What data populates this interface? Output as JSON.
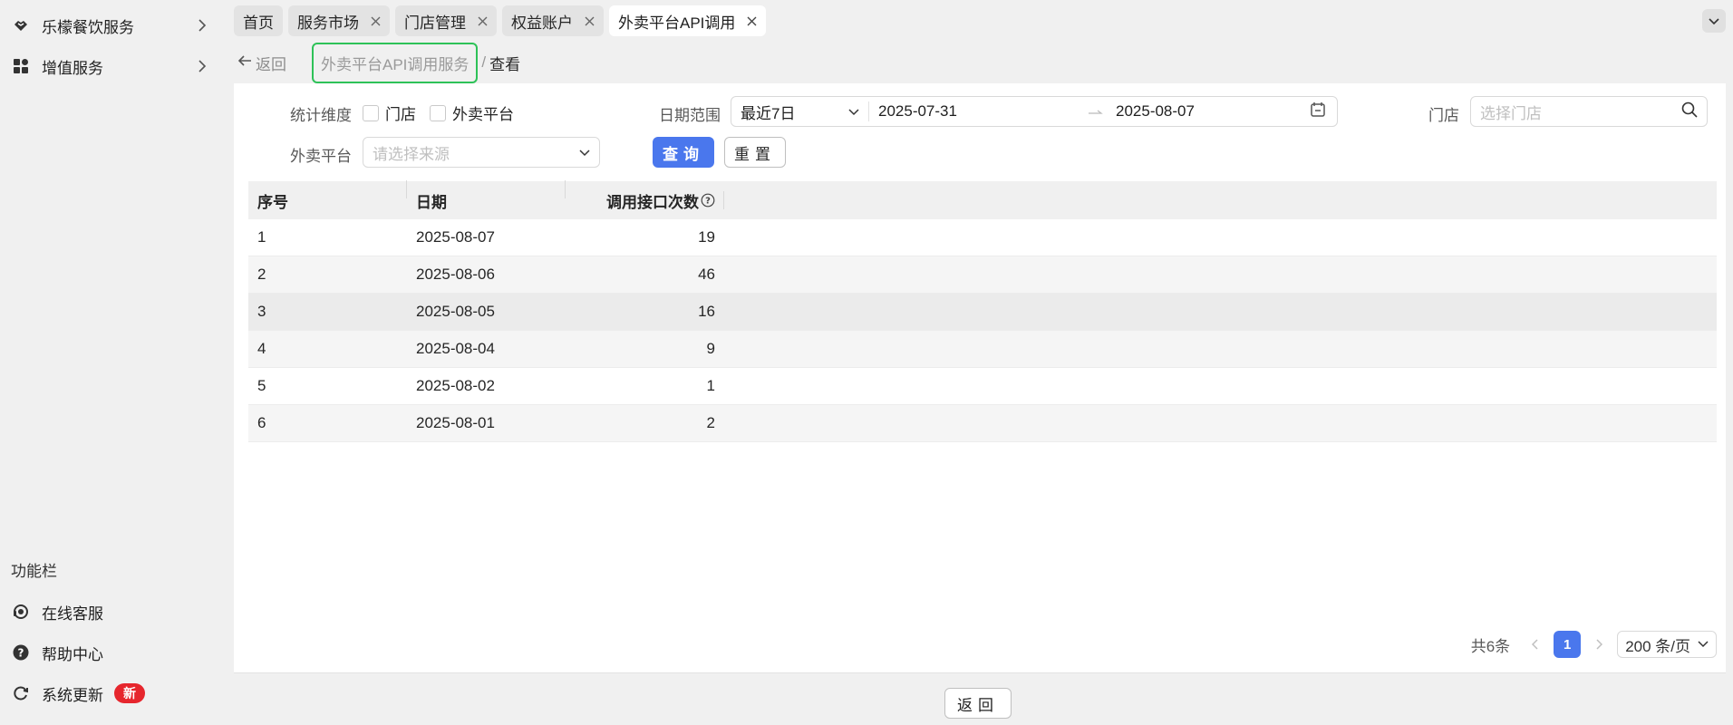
{
  "sidebar": {
    "items": [
      {
        "label": "乐檬餐饮服务",
        "icon": "handshake-icon"
      },
      {
        "label": "增值服务",
        "icon": "apps-grid-icon"
      }
    ],
    "section_title": "功能栏",
    "bottom_items": [
      {
        "label": "在线客服",
        "icon": "headset-icon"
      },
      {
        "label": "帮助中心",
        "icon": "help-circle-icon"
      },
      {
        "label": "系统更新",
        "icon": "refresh-icon",
        "badge": "新"
      }
    ]
  },
  "tabs": [
    {
      "label": "首页",
      "closable": false
    },
    {
      "label": "服务市场",
      "closable": true
    },
    {
      "label": "门店管理",
      "closable": true
    },
    {
      "label": "权益账户",
      "closable": true
    },
    {
      "label": "外卖平台API调用",
      "closable": true,
      "active": true
    }
  ],
  "breadcrumb": {
    "back": "返回",
    "service": "外卖平台API调用服务",
    "separator": "/",
    "current": "查看"
  },
  "filters": {
    "dimension_label": "统计维度",
    "dimension_options": [
      "门店",
      "外卖平台"
    ],
    "date_label": "日期范围",
    "date_preset": "最近7日",
    "date_start": "2025-07-31",
    "date_end": "2025-08-07",
    "store_label": "门店",
    "store_placeholder": "选择门店",
    "platform_label": "外卖平台",
    "platform_placeholder": "请选择来源",
    "query_button": "查询",
    "reset_button": "重置"
  },
  "table": {
    "columns": [
      "序号",
      "日期",
      "调用接口次数"
    ],
    "rows": [
      {
        "index": "1",
        "date": "2025-08-07",
        "count": "19"
      },
      {
        "index": "2",
        "date": "2025-08-06",
        "count": "46"
      },
      {
        "index": "3",
        "date": "2025-08-05",
        "count": "16"
      },
      {
        "index": "4",
        "date": "2025-08-04",
        "count": "9"
      },
      {
        "index": "5",
        "date": "2025-08-02",
        "count": "1"
      },
      {
        "index": "6",
        "date": "2025-08-01",
        "count": "2"
      }
    ]
  },
  "pagination": {
    "total": "共6条",
    "current_page": "1",
    "page_size": "200 条/页"
  },
  "footer": {
    "back_button": "返回"
  },
  "colors": {
    "primary": "#4a77ed",
    "highlight_border": "#2ec258",
    "badge": "#e6262d"
  }
}
